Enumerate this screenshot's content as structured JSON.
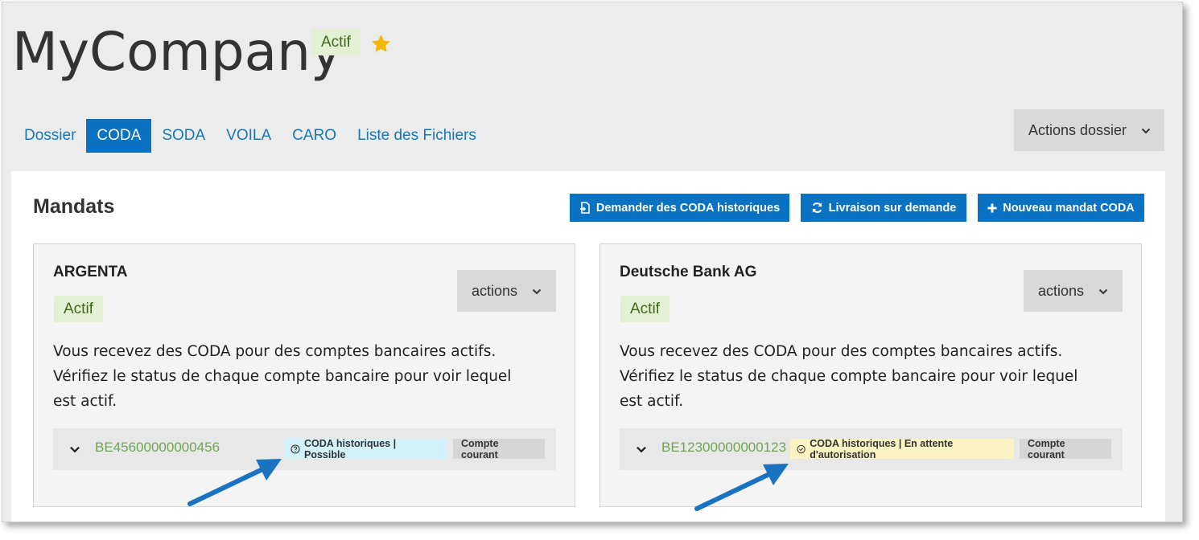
{
  "company": {
    "name": "MyCompany",
    "status": "Actif",
    "favorite_icon": "star-icon"
  },
  "tabs": [
    {
      "label": "Dossier",
      "active": false
    },
    {
      "label": "CODA",
      "active": true
    },
    {
      "label": "SODA",
      "active": false
    },
    {
      "label": "VOILA",
      "active": false
    },
    {
      "label": "CARO",
      "active": false
    },
    {
      "label": "Liste des Fichiers",
      "active": false
    }
  ],
  "actions_dossier": {
    "label": "Actions dossier",
    "icon": "chevron-down-icon"
  },
  "mandates": {
    "title": "Mandats",
    "buttons": {
      "historical": "Demander des CODA historiques",
      "on_demand": "Livraison sur demande",
      "new_mandate": "Nouveau mandat CODA"
    },
    "cards": [
      {
        "bank": "ARGENTA",
        "status": "Actif",
        "actions_label": "actions",
        "description": "Vous recevez des CODA pour des comptes bancaires actifs. Vérifiez le status de chaque compte bancaire pour voir lequel est actif.",
        "account": {
          "iban": "BE45600000000456",
          "historical_status": "CODA historiques | Possible",
          "type": "Compte courant"
        }
      },
      {
        "bank": "Deutsche Bank AG",
        "status": "Actif",
        "actions_label": "actions",
        "description": "Vous recevez des CODA pour des comptes bancaires actifs. Vérifiez le status de chaque compte bancaire pour voir lequel est actif.",
        "account": {
          "iban": "BE12300000000123",
          "historical_status": "CODA historiques | En attente d'autorisation",
          "type": "Compte courant"
        }
      }
    ]
  },
  "colors": {
    "primary": "#0a72c2",
    "link": "#1577b8",
    "active_badge_bg": "#e3f0d3",
    "active_badge_text": "#3d6b1e",
    "iban": "#6aa84f",
    "possible_bg": "#d3f1fb",
    "pending_bg": "#fbf3c2",
    "star": "#f5b800",
    "annotation_arrow": "#1a73c0"
  }
}
